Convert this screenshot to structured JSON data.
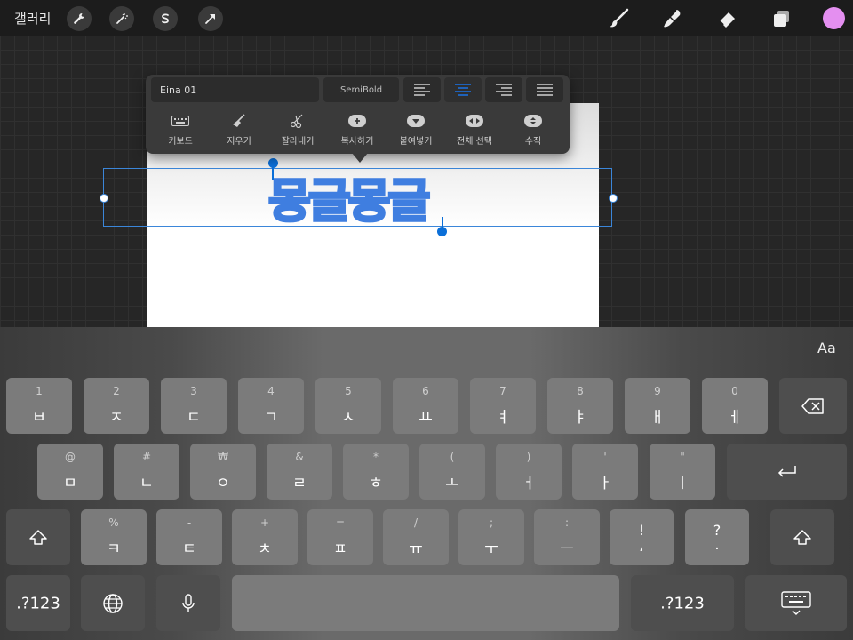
{
  "topbar": {
    "gallery_label": "갤러리"
  },
  "colors": {
    "accent": "#1a73e8",
    "brush_color": "#e48ff0",
    "text_fill": "#c38df2",
    "text_stroke": "#3f7ee0"
  },
  "canvas": {
    "text": "몽글몽글"
  },
  "text_popover": {
    "font_name": "Eina 01",
    "font_weight": "SemiBold",
    "alignment_selected": "center",
    "actions": [
      {
        "label": "키보드",
        "icon": "keyboard-icon"
      },
      {
        "label": "지우기",
        "icon": "broom-icon"
      },
      {
        "label": "잘라내기",
        "icon": "scissors-icon"
      },
      {
        "label": "복사하기",
        "icon": "plus-icon"
      },
      {
        "label": "붙여넣기",
        "icon": "dropdown-icon"
      },
      {
        "label": "전체 선택",
        "icon": "select-all-icon"
      },
      {
        "label": "수직",
        "icon": "vertical-icon"
      }
    ]
  },
  "keyboard": {
    "aa_label": "Aa",
    "row1": [
      {
        "top": "1",
        "main": "ㅂ"
      },
      {
        "top": "2",
        "main": "ㅈ"
      },
      {
        "top": "3",
        "main": "ㄷ"
      },
      {
        "top": "4",
        "main": "ㄱ"
      },
      {
        "top": "5",
        "main": "ㅅ"
      },
      {
        "top": "6",
        "main": "ㅛ"
      },
      {
        "top": "7",
        "main": "ㅕ"
      },
      {
        "top": "8",
        "main": "ㅑ"
      },
      {
        "top": "9",
        "main": "ㅐ"
      },
      {
        "top": "0",
        "main": "ㅔ"
      }
    ],
    "row2": [
      {
        "top": "@",
        "main": "ㅁ"
      },
      {
        "top": "#",
        "main": "ㄴ"
      },
      {
        "top": "₩",
        "main": "ㅇ"
      },
      {
        "top": "&",
        "main": "ㄹ"
      },
      {
        "top": "*",
        "main": "ㅎ"
      },
      {
        "top": "(",
        "main": "ㅗ"
      },
      {
        "top": ")",
        "main": "ㅓ"
      },
      {
        "top": "'",
        "main": "ㅏ"
      },
      {
        "top": "\"",
        "main": "ㅣ"
      }
    ],
    "row3": [
      {
        "top": "%",
        "main": "ㅋ"
      },
      {
        "top": "-",
        "main": "ㅌ"
      },
      {
        "top": "+",
        "main": "ㅊ"
      },
      {
        "top": "=",
        "main": "ㅍ"
      },
      {
        "top": "/",
        "main": "ㅠ"
      },
      {
        "top": ";",
        "main": "ㅜ"
      },
      {
        "top": ":",
        "main": "ㅡ"
      },
      {
        "top": "!",
        "main": ","
      },
      {
        "top": "?",
        "main": "."
      }
    ],
    "numbers_label": ".?123"
  }
}
